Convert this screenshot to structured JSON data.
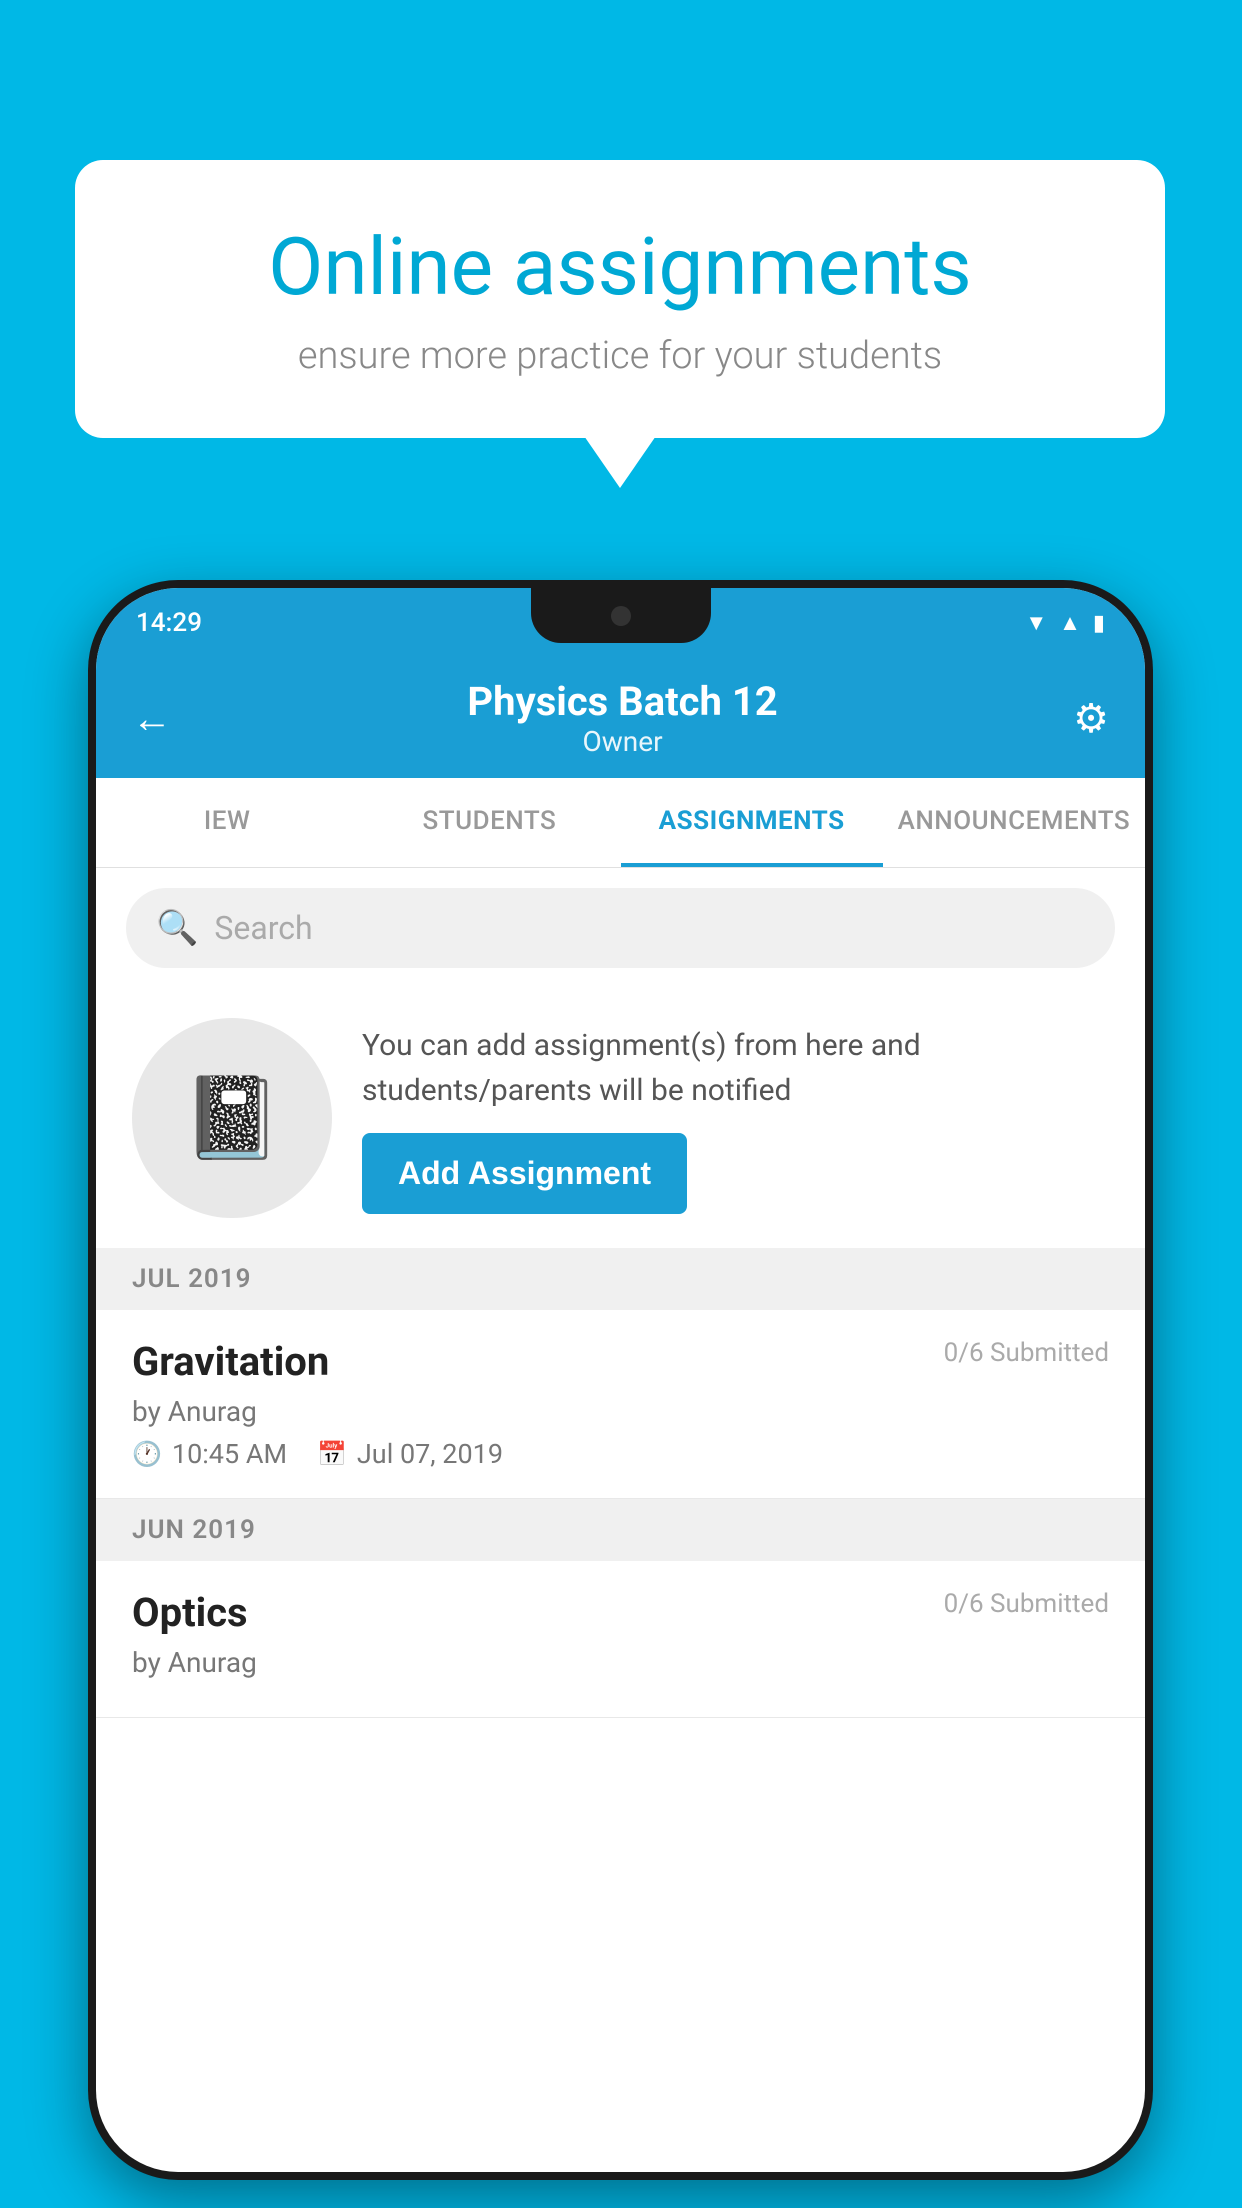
{
  "background_color": "#00b8e6",
  "speech_bubble": {
    "title": "Online assignments",
    "subtitle": "ensure more practice for your students"
  },
  "status_bar": {
    "time": "14:29",
    "icons": [
      "wifi",
      "signal",
      "battery"
    ]
  },
  "app_header": {
    "title": "Physics Batch 12",
    "subtitle": "Owner",
    "back_icon": "←",
    "settings_icon": "⚙"
  },
  "tabs": [
    {
      "label": "IEW",
      "active": false
    },
    {
      "label": "STUDENTS",
      "active": false
    },
    {
      "label": "ASSIGNMENTS",
      "active": true
    },
    {
      "label": "ANNOUNCEMENTS",
      "active": false
    }
  ],
  "search": {
    "placeholder": "Search"
  },
  "promo": {
    "icon": "📓",
    "text": "You can add assignment(s) from here and students/parents will be notified",
    "button_label": "Add Assignment"
  },
  "sections": [
    {
      "label": "JUL 2019",
      "assignments": [
        {
          "name": "Gravitation",
          "submitted": "0/6 Submitted",
          "author": "by Anurag",
          "time": "10:45 AM",
          "date": "Jul 07, 2019"
        }
      ]
    },
    {
      "label": "JUN 2019",
      "assignments": [
        {
          "name": "Optics",
          "submitted": "0/6 Submitted",
          "author": "by Anurag",
          "time": "",
          "date": ""
        }
      ]
    }
  ]
}
